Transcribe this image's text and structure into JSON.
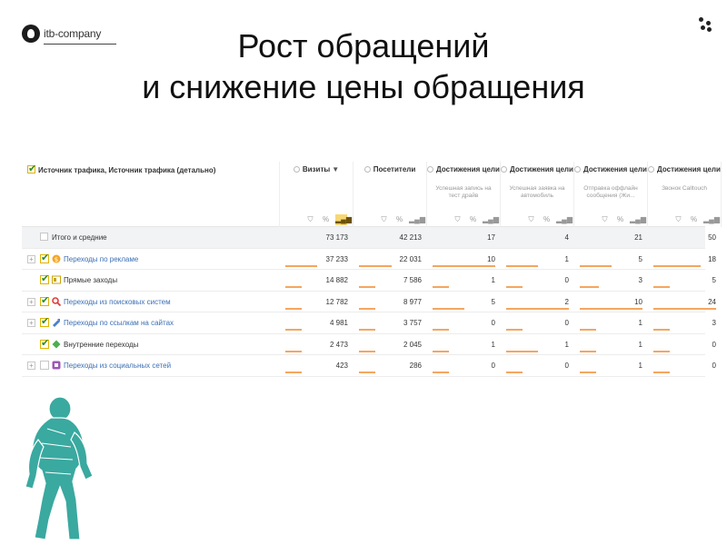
{
  "logo": {
    "text": "itb-company"
  },
  "title": {
    "line1": "Рост обращений",
    "line2": "и снижение цены обращения"
  },
  "colors": {
    "accent": "#f4a660",
    "link": "#3a6fb5",
    "active_icon": "#f7d774",
    "ape": "#3aa9a0"
  },
  "table": {
    "first_header": "Источник трафика, Источник трафика (детально)",
    "columns": [
      {
        "title": "Визиты",
        "sort": "▼",
        "subtitle": ""
      },
      {
        "title": "Посетители",
        "sort": "",
        "subtitle": ""
      },
      {
        "title": "Достижения цели",
        "sort": "",
        "subtitle": "Успешная запись на тест драйв"
      },
      {
        "title": "Достижения цели",
        "sort": "",
        "subtitle": "Успешная заявка на автомобиль"
      },
      {
        "title": "Достижения цели",
        "sort": "",
        "subtitle": "Отправка оффлайн сообщения (Жи..."
      },
      {
        "title": "Достижения цели",
        "sort": "",
        "subtitle": "Звонок Calltouch"
      }
    ],
    "col_icons": [
      "filter-icon",
      "percent-icon",
      "chart-icon"
    ],
    "rows": [
      {
        "name": "Итого и средние",
        "values": [
          "73 173",
          "42 213",
          "17",
          "4",
          "21",
          "50"
        ],
        "fill": [
          0,
          0,
          0,
          0,
          0,
          0
        ]
      },
      {
        "name": "Переходы по рекламе",
        "values": [
          "37 233",
          "22 031",
          "10",
          "1",
          "5",
          "18"
        ],
        "fill": [
          0.51,
          0.52,
          1.0,
          0.5,
          0.5,
          0.75
        ]
      },
      {
        "name": "Прямые заходы",
        "values": [
          "14 882",
          "7 586",
          "1",
          "0",
          "3",
          "5"
        ],
        "fill": [
          0.2,
          0.18,
          0.1,
          0,
          0.3,
          0.2
        ]
      },
      {
        "name": "Переходы из поисковых систем",
        "values": [
          "12 782",
          "8 977",
          "5",
          "2",
          "10",
          "24"
        ],
        "fill": [
          0.17,
          0.21,
          0.5,
          1.0,
          1.0,
          1.0
        ]
      },
      {
        "name": "Переходы по ссылкам на сайтах",
        "values": [
          "4 981",
          "3 757",
          "0",
          "0",
          "1",
          "3"
        ],
        "fill": [
          0.07,
          0.09,
          0,
          0,
          0.1,
          0.12
        ]
      },
      {
        "name": "Внутренние переходы",
        "values": [
          "2 473",
          "2 045",
          "1",
          "1",
          "1",
          "0"
        ],
        "fill": [
          0.03,
          0.05,
          0.1,
          0.5,
          0.1,
          0
        ]
      },
      {
        "name": "Переходы из социальных сетей",
        "values": [
          "423",
          "286",
          "0",
          "0",
          "1",
          "0"
        ],
        "fill": [
          0.01,
          0.01,
          0,
          0,
          0.1,
          0
        ]
      }
    ]
  }
}
